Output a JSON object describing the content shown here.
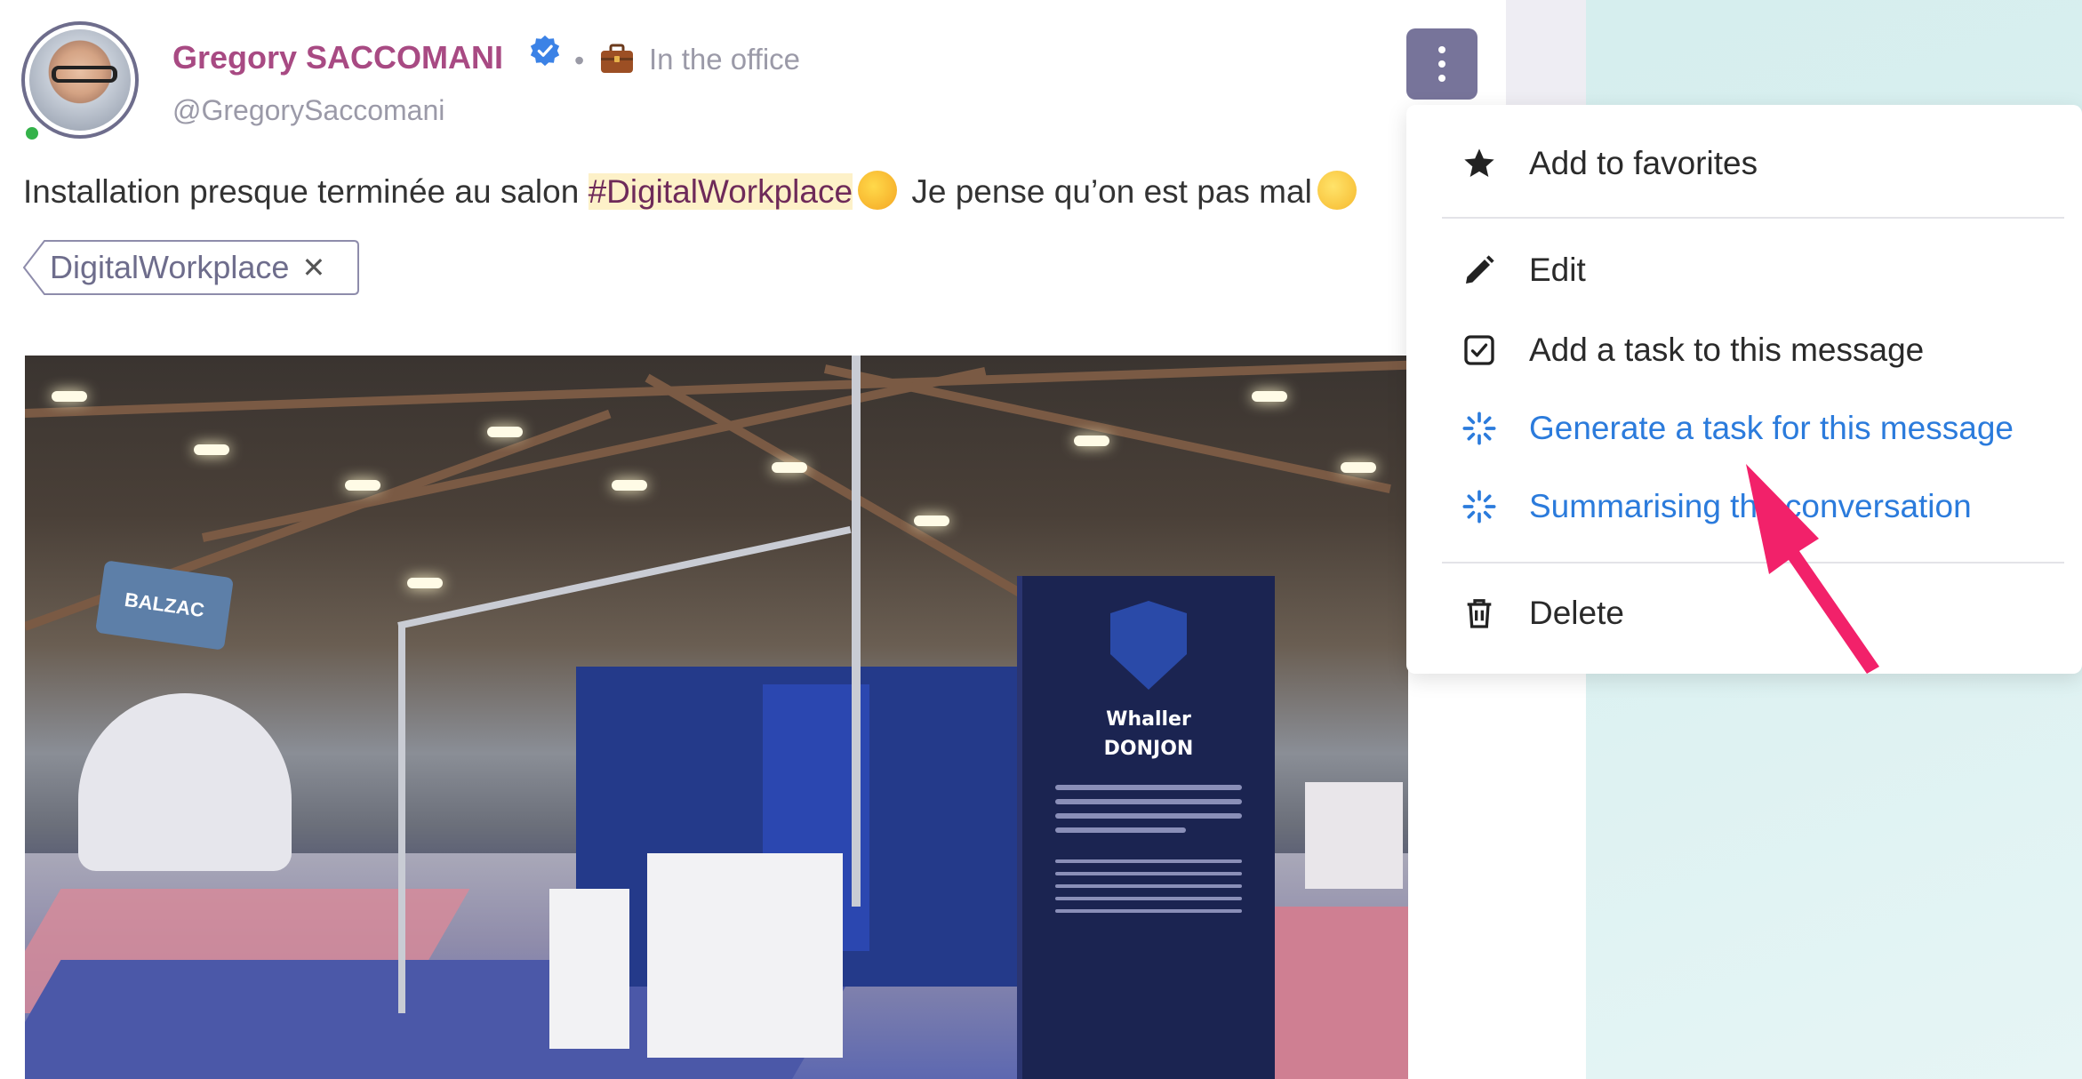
{
  "post": {
    "author_name": "Gregory SACCOMANI",
    "author_handle": "@GregorySaccomani",
    "status_separator": "•",
    "status_text": "In the office",
    "message_before": "Installation presque terminée au salon ",
    "hashtag": "#DigitalWorkplace",
    "message_after": " Je pense qu’on est pas mal",
    "tag_label": "DigitalWorkplace",
    "tag_remove_glyph": "✕",
    "colors": {
      "author": "#a84a83",
      "hashtag_bg": "#fdf1c8",
      "menu_button": "#77749a",
      "presence": "#34b24a"
    }
  },
  "photo": {
    "balzac_sign": "BALZAC",
    "banner_brand": "Whaller",
    "banner_product": "DONJON"
  },
  "menu": {
    "items": [
      {
        "label": "Add to favorites",
        "icon": "star-icon"
      },
      {
        "label": "Edit",
        "icon": "pencil-icon"
      },
      {
        "label": "Add a task to this message",
        "icon": "checkbox-icon"
      },
      {
        "label": "Generate a task for this message",
        "icon": "sparkle-icon",
        "accent": "#2b7bdc"
      },
      {
        "label": "Summarising the conversation",
        "icon": "sparkle-icon",
        "accent": "#2b7bdc"
      },
      {
        "label": "Delete",
        "icon": "trash-icon"
      }
    ]
  },
  "annotation": {
    "arrow_color": "#f2216a"
  }
}
